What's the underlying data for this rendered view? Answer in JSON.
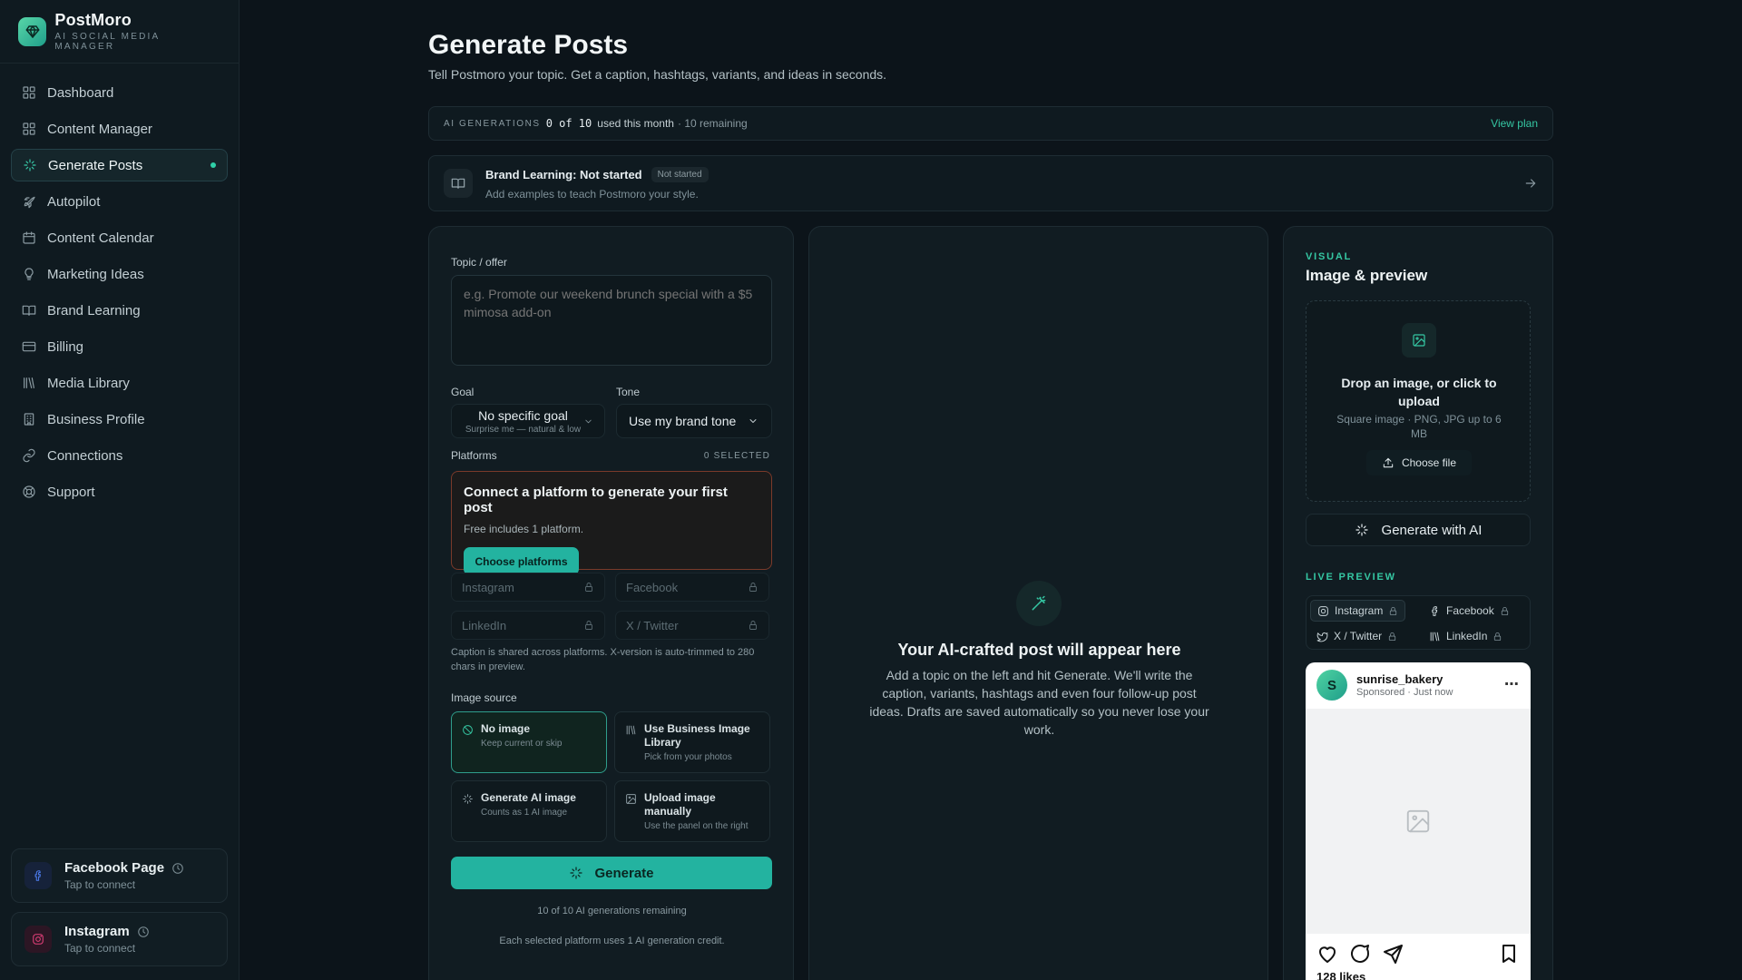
{
  "app": {
    "name": "PostMoro",
    "tagline": "AI SOCIAL MEDIA MANAGER"
  },
  "sidebar": {
    "items": [
      {
        "label": "Dashboard",
        "icon": "grid-icon"
      },
      {
        "label": "Content Manager",
        "icon": "grid-icon"
      },
      {
        "label": "Generate Posts",
        "icon": "sparkle-icon",
        "active": true
      },
      {
        "label": "Autopilot",
        "icon": "rocket-icon"
      },
      {
        "label": "Content Calendar",
        "icon": "calendar-icon"
      },
      {
        "label": "Marketing Ideas",
        "icon": "lightbulb-icon"
      },
      {
        "label": "Brand Learning",
        "icon": "book-icon"
      },
      {
        "label": "Billing",
        "icon": "card-icon"
      },
      {
        "label": "Media Library",
        "icon": "library-icon"
      },
      {
        "label": "Business Profile",
        "icon": "building-icon"
      },
      {
        "label": "Connections",
        "icon": "link-icon"
      },
      {
        "label": "Support",
        "icon": "lifebuoy-icon"
      }
    ],
    "connections": [
      {
        "title": "Facebook Page",
        "sub": "Tap to connect"
      },
      {
        "title": "Instagram",
        "sub": "Tap to connect"
      }
    ]
  },
  "header": {
    "title": "Generate Posts",
    "subtitle": "Tell Postmoro your topic. Get a caption, hashtags, variants, and ideas in seconds."
  },
  "generations": {
    "label": "AI GENERATIONS",
    "count": "0 of 10",
    "used": "used this month",
    "remaining": "· 10 remaining",
    "view_plan": "View plan"
  },
  "brand_learning": {
    "title": "Brand Learning: Not started",
    "badge": "Not started",
    "sub": "Add examples to teach Postmoro your style."
  },
  "form": {
    "topic_label": "Topic / offer",
    "topic_placeholder": "e.g. Promote our weekend brunch special with a $5 mimosa add-on",
    "goal_label": "Goal",
    "goal_value": "No specific goal",
    "goal_sub": "Surprise me — natural & low",
    "tone_label": "Tone",
    "tone_value": "Use my brand tone",
    "platforms_label": "Platforms",
    "platforms_selected": "0 SELECTED",
    "connect_title": "Connect a platform to generate your first post",
    "connect_sub": "Free includes 1 platform.",
    "choose_platforms": "Choose platforms",
    "platforms": [
      "Instagram",
      "Facebook",
      "LinkedIn",
      "X / Twitter"
    ],
    "caption_note": "Caption is shared across platforms. X-version is auto-trimmed to 280 chars in preview.",
    "image_source_label": "Image source",
    "image_options": [
      {
        "title": "No image",
        "sub": "Keep current or skip"
      },
      {
        "title": "Use Business Image Library",
        "sub": "Pick from your photos"
      },
      {
        "title": "Generate AI image",
        "sub": "Counts as 1 AI image"
      },
      {
        "title": "Upload image manually",
        "sub": "Use the panel on the right"
      }
    ],
    "generate_label": "Generate",
    "remaining_note": "10 of 10 AI generations remaining",
    "credit_note": "Each selected platform uses 1 AI generation credit."
  },
  "output": {
    "title": "Your AI-crafted post will appear here",
    "text": "Add a topic on the left and hit Generate. We'll write the caption, variants, hashtags and even four follow-up post ideas. Drafts are saved automatically so you never lose your work."
  },
  "visual": {
    "tag": "VISUAL",
    "title": "Image & preview",
    "drop_title": "Drop an image, or click to upload",
    "drop_sub": "Square image · PNG, JPG up to 6 MB",
    "choose_file": "Choose file",
    "generate_ai": "Generate with AI",
    "live_tag": "LIVE PREVIEW",
    "preview_tabs": [
      "Instagram",
      "Facebook",
      "X / Twitter",
      "LinkedIn"
    ],
    "post": {
      "avatar_letter": "S",
      "username": "sunrise_bakery",
      "meta": "Sponsored · Just now",
      "likes": "128 likes"
    }
  },
  "colors": {
    "accent": "#23b3a0",
    "background": "#0c141a",
    "warning_border": "#7a3a2a"
  }
}
